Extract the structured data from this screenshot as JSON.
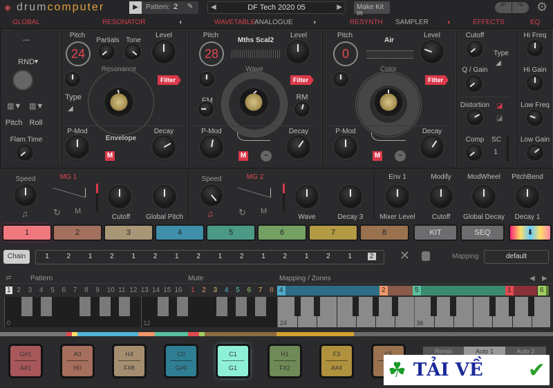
{
  "header": {
    "logo_a": "drum",
    "logo_b": "computer",
    "pattern_label": "Pattern:",
    "pattern_value": "2",
    "preset": "DF Tech 2020 05",
    "make_kit": "Make Kit"
  },
  "tabs": [
    "GLOBAL",
    "RESONATOR",
    "WAVETABLE",
    "ANALOGUE",
    "RESYNTH",
    "SAMPLER",
    "EFFECTS",
    "EQ"
  ],
  "global": {
    "dash": "---",
    "rnd": "RND",
    "pitch": "Pitch",
    "roll": "Roll",
    "flam": "Flam Time"
  },
  "resonator": {
    "pitch": "Pitch",
    "pitch_value": "24",
    "partials": "Partials",
    "tone": "Tone",
    "level": "Level",
    "resonance": "Resonance",
    "filter": "Filter",
    "type": "Type",
    "pmod": "P-Mod",
    "envelope": "Envelope",
    "decay": "Decay"
  },
  "wavetable": {
    "pitch": "Pitch",
    "pitch_value": "28",
    "wave_name": "Mths Scal2",
    "level": "Level",
    "wave": "Wave",
    "filter": "Filter",
    "fm": "FM",
    "rm": "RM",
    "pmod": "P-Mod",
    "decay": "Decay"
  },
  "resynth": {
    "pitch": "Pitch",
    "pitch_value": "0",
    "sample": "Air",
    "level": "Level",
    "color": "Color",
    "filter": "Filter",
    "pmod": "P-Mod",
    "decay": "Decay"
  },
  "effects": {
    "cutoff": "Cutoff",
    "type": "Type",
    "qgain": "Q / Gain",
    "distortion": "Distortion",
    "comp": "Comp",
    "sc": "SC",
    "sc_value": "1"
  },
  "eq": {
    "hifreq": "Hi Freq",
    "higain": "Hi Gain",
    "lowfreq": "Low Freq",
    "lowgain": "Low Gain"
  },
  "mod": {
    "speed1": "Speed",
    "mg1": "MG 1",
    "cutoff": "Cutoff",
    "globalpitch": "Global Pitch",
    "speed2": "Speed",
    "mg2": "MG 2",
    "wave": "Wave",
    "decay3": "Decay 3",
    "env1": "Env 1",
    "mixer": "Mixer Level",
    "modify": "Modify",
    "cutoff2": "Cutoff",
    "modwheel": "ModWheel",
    "globaldecay": "Global Decay",
    "pitchbend": "PitchBend",
    "decay1": "Decay 1"
  },
  "channels": [
    {
      "label": "1",
      "color": "#f2787f"
    },
    {
      "label": "2",
      "color": "#a4705e"
    },
    {
      "label": "3",
      "color": "#a99676"
    },
    {
      "label": "4",
      "color": "#3f8faa"
    },
    {
      "label": "5",
      "color": "#4b9a86"
    },
    {
      "label": "6",
      "color": "#74a063"
    },
    {
      "label": "7",
      "color": "#b39a44"
    },
    {
      "label": "8",
      "color": "#9a7250"
    },
    {
      "label": "KIT",
      "color": "#6d6d70"
    },
    {
      "label": "SEQ",
      "color": "#6d6d70"
    }
  ],
  "chain": {
    "label": "Chain",
    "steps": [
      "1",
      "2",
      "1",
      "2",
      "1",
      "2",
      "1",
      "2",
      "1",
      "2",
      "1",
      "2",
      "1",
      "2",
      "1",
      "2"
    ],
    "mapping_label": "Mapping",
    "mapping_value": "default"
  },
  "sequencer": {
    "pattern": "Pattern",
    "mute": "Mute",
    "zones": "Mapping / Zones",
    "patterns": [
      "1",
      "2",
      "3",
      "4",
      "5",
      "6",
      "7",
      "8",
      "9",
      "10",
      "11",
      "12",
      "13",
      "14",
      "15",
      "16"
    ],
    "mutes": [
      {
        "n": "1",
        "c": "#e04a50"
      },
      {
        "n": "2",
        "c": "#f0976a"
      },
      {
        "n": "3",
        "c": "#e8c07a"
      },
      {
        "n": "4",
        "c": "#4fb3d6"
      },
      {
        "n": "5",
        "c": "#5fd1b0"
      },
      {
        "n": "6",
        "c": "#9bd16a"
      },
      {
        "n": "7",
        "c": "#e0b84a"
      },
      {
        "n": "8",
        "c": "#c08a5a"
      }
    ],
    "zone_labels": [
      {
        "n": "4",
        "c": "#4fa9c9",
        "z": "#2e6d85"
      },
      {
        "n": "2",
        "c": "#f0976a",
        "z": "#8a5a4a"
      },
      {
        "n": "5",
        "c": "#5ac0a0",
        "z": "#3a8a70"
      },
      {
        "n": "1",
        "c": "#e04a50",
        "z": "#8a3038"
      },
      {
        "n": "6",
        "c": "#a0d060",
        "z": "#5a7a3a"
      }
    ],
    "octaves": [
      "0",
      "12",
      "24",
      "36"
    ]
  },
  "pads": [
    {
      "t": "G#1",
      "b": "A#1",
      "c": "#a8575a"
    },
    {
      "t": "A0",
      "b": "H0",
      "c": "#a66e5c"
    },
    {
      "t": "H4",
      "b": "F#8",
      "c": "#a58e70"
    },
    {
      "t": "C0",
      "b": "G#0",
      "c": "#2f7f94"
    },
    {
      "t": "C1",
      "b": "G1",
      "c": "#8ff0d8"
    },
    {
      "t": "H1",
      "b": "F#2",
      "c": "#6f8a56"
    },
    {
      "t": "F3",
      "b": "A#4",
      "c": "#b0923e"
    },
    {
      "t": "C5",
      "b": "",
      "c": "#9a7250"
    }
  ],
  "remix_tabs": [
    "Remix",
    "Auto 1",
    "Auto 2"
  ],
  "watermark": "TẢI VỀ"
}
